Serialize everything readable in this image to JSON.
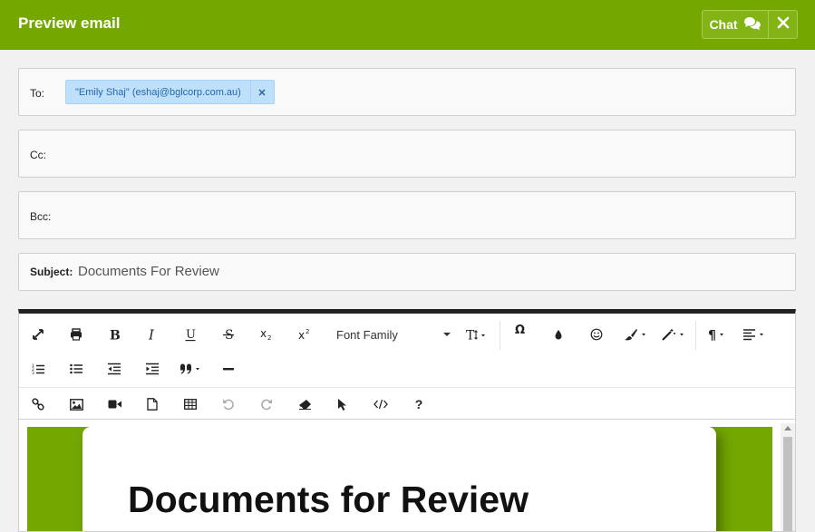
{
  "header": {
    "title": "Preview email",
    "chat_label": "Chat"
  },
  "to": {
    "label": "To:",
    "recipients": [
      {
        "text": "\"Emily Shaj\" (eshaj@bglcorp.com.au)"
      }
    ]
  },
  "cc": {
    "label": "Cc:"
  },
  "bcc": {
    "label": "Bcc:"
  },
  "subject": {
    "label": "Subject:",
    "value": "Documents For Review"
  },
  "toolbar": {
    "font_family": "Font Family",
    "row1_icons": [
      "fullscreen-icon",
      "print-icon",
      "bold-icon",
      "italic-icon",
      "underline-icon",
      "strikethrough-icon",
      "subscript-icon",
      "superscript-icon",
      "font-size-icon",
      "special-character-icon",
      "color-icon",
      "emoticons-icon",
      "paint-brush-icon",
      "magic-wand-icon",
      "paragraph-format-icon",
      "align-icon"
    ],
    "row2_icons": [
      "ordered-list-icon",
      "unordered-list-icon",
      "outdent-icon",
      "indent-icon",
      "quote-icon",
      "horizontal-line-icon"
    ],
    "row3_icons": [
      "link-icon",
      "image-icon",
      "video-icon",
      "file-icon",
      "table-icon",
      "undo-icon",
      "redo-icon",
      "clear-formatting-icon",
      "select-all-icon",
      "code-view-icon",
      "help-icon"
    ],
    "help_glyph": "?"
  },
  "body": {
    "heading": "Documents for Review"
  },
  "colors": {
    "brand": "#74a800",
    "chip_bg": "#bfe0fb",
    "chip_text": "#2566a8"
  }
}
